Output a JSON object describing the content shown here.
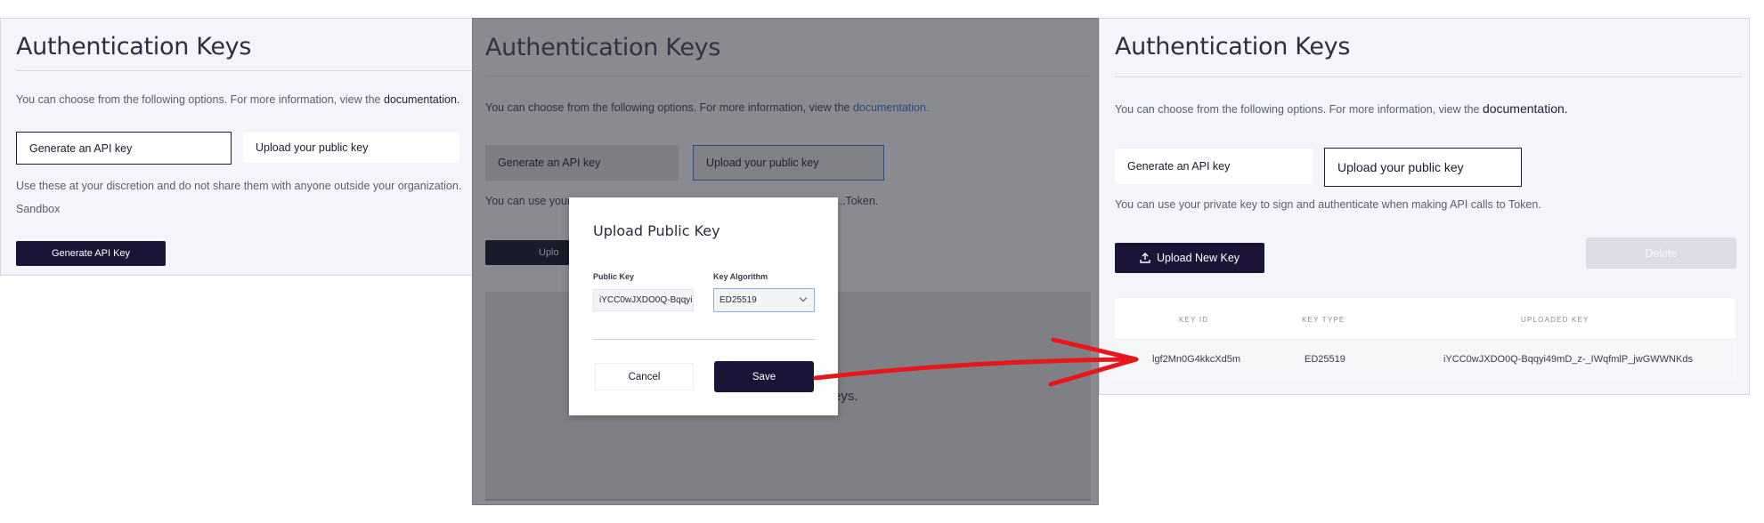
{
  "panel1": {
    "title": "Authentication Keys",
    "info_text": "You can choose from the following options. For more information, view the ",
    "info_link": "documentation.",
    "options": [
      "Generate an API key",
      "Upload your public key"
    ],
    "helper_text": "Use these at your discretion and do not share them with anyone outside your organization.",
    "environment": "Sandbox",
    "generate_button": "Generate API Key"
  },
  "panel2": {
    "title": "Authentication Keys",
    "info_text": "You can choose from the following options. For more information, view the ",
    "info_link": "documentation.",
    "options": [
      "Generate an API key",
      "Upload your public key"
    ],
    "helper_text_start": "You can use your p",
    "helper_text_end": "...Token.",
    "upload_button_partial": "Uplo",
    "empty_text_partial": "eys.",
    "modal": {
      "title": "Upload Public Key",
      "public_key_label": "Public Key",
      "public_key_value": "iYCC0wJXDO0Q-Bqqyi",
      "algorithm_label": "Key Algorithm",
      "algorithm_value": "ED25519",
      "cancel_label": "Cancel",
      "save_label": "Save"
    }
  },
  "panel3": {
    "title": "Authentication Keys",
    "info_text": "You can choose from the following options. For more information, view the ",
    "info_link": "documentation.",
    "options": [
      "Generate an API key",
      "Upload your public key"
    ],
    "helper_text": "You can use your private key to sign and authenticate when making API calls to Token.",
    "upload_button": "Upload New Key",
    "delete_button": "Delete",
    "table": {
      "headers": [
        "KEY ID",
        "KEY TYPE",
        "UPLOADED KEY"
      ],
      "rows": [
        [
          "lgf2Mn0G4kkcXd5m",
          "ED25519",
          "iYCC0wJXDO0Q-Bqqyi49mD_z-_IWqfmlP_jwGWWNKds"
        ]
      ]
    }
  },
  "colors": {
    "accent_dark": "#1c1437",
    "arrow": "#e8161b",
    "overlay": "#8a8b90"
  },
  "icons": [
    "upload-icon",
    "chevron-down-icon",
    "arrow-annotation"
  ]
}
